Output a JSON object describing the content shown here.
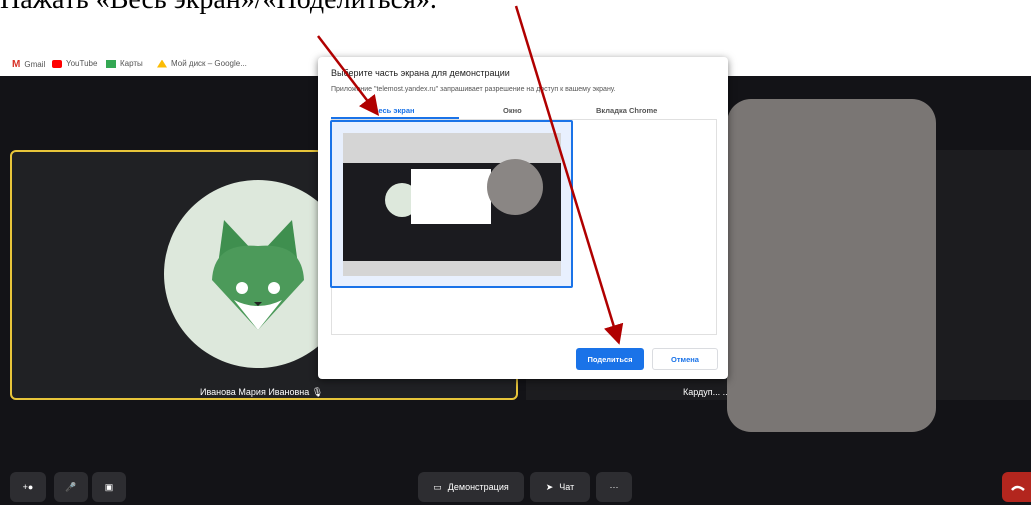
{
  "caption": "Нажать «Весь экран»/«Поделиться».",
  "bookmarks": [
    {
      "label": "Gmail",
      "icon": "gmail-icon",
      "color": "#d93025"
    },
    {
      "label": "YouTube",
      "icon": "youtube-icon",
      "color": "#ff0000"
    },
    {
      "label": "Карты",
      "icon": "maps-icon",
      "color": "#34a853"
    },
    {
      "label": "Мой диск – Google...",
      "icon": "drive-icon",
      "color": "#fbbc04"
    }
  ],
  "participants": [
    {
      "name": "Иванова Мария Ивановна",
      "mic_icon": "mic-icon"
    },
    {
      "name": "Кардуп... ...",
      "mic_icon": "mic-icon"
    }
  ],
  "dialog": {
    "title": "Выберите часть экрана для демонстрации",
    "subtitle": "Приложение \"telemost.yandex.ru\" запрашивает разрешение на доступ к вашему экрану.",
    "tabs": [
      "Весь экран",
      "Окно",
      "Вкладка Chrome"
    ],
    "active_tab": "Весь экран",
    "share_label": "Поделиться",
    "cancel_label": "Отмена"
  },
  "controls": {
    "demo_label": "Демонстрация",
    "chat_label": "Чат",
    "more_label": "···"
  },
  "colors": {
    "accent": "#1a73e8",
    "highlight": "#e7c53a",
    "arrow": "#b00000",
    "end_call": "#b3261e"
  }
}
